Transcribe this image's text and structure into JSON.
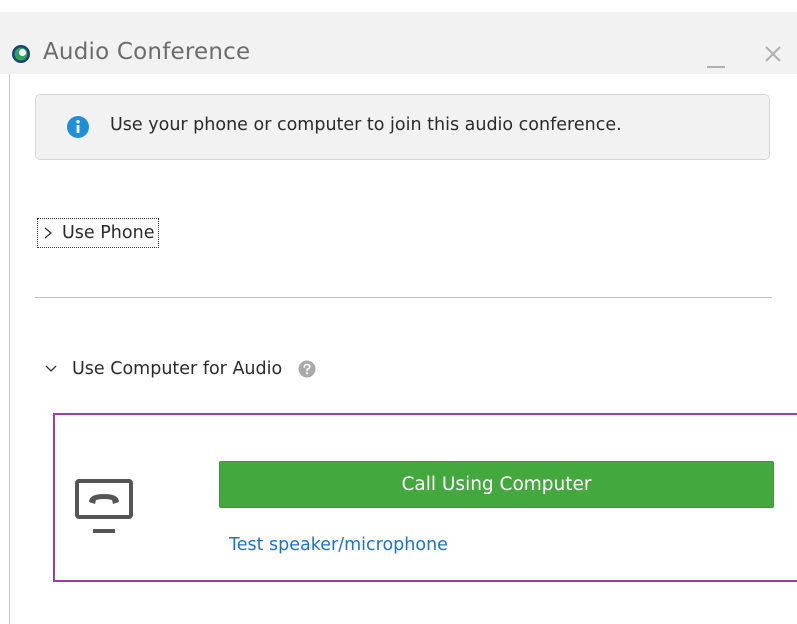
{
  "window": {
    "title": "Audio Conference",
    "icons": {
      "app": "app-logo-icon",
      "minimize": "minimize-icon",
      "close": "close-icon"
    }
  },
  "info": {
    "icon": "info-icon",
    "text": "Use your phone or computer to join this audio conference."
  },
  "phone_section": {
    "label": "Use Phone",
    "state": "collapsed"
  },
  "computer_section": {
    "label": "Use Computer for Audio",
    "state": "expanded",
    "help_icon": "help-icon",
    "device_icon": "computer-phone-icon",
    "call_button_label": "Call Using Computer",
    "test_link_label": "Test speaker/microphone"
  },
  "colors": {
    "accent_green": "#43a83d",
    "link_blue": "#1a73c7",
    "panel_border": "#9b3fa6",
    "info_blue": "#1e8fd8"
  }
}
